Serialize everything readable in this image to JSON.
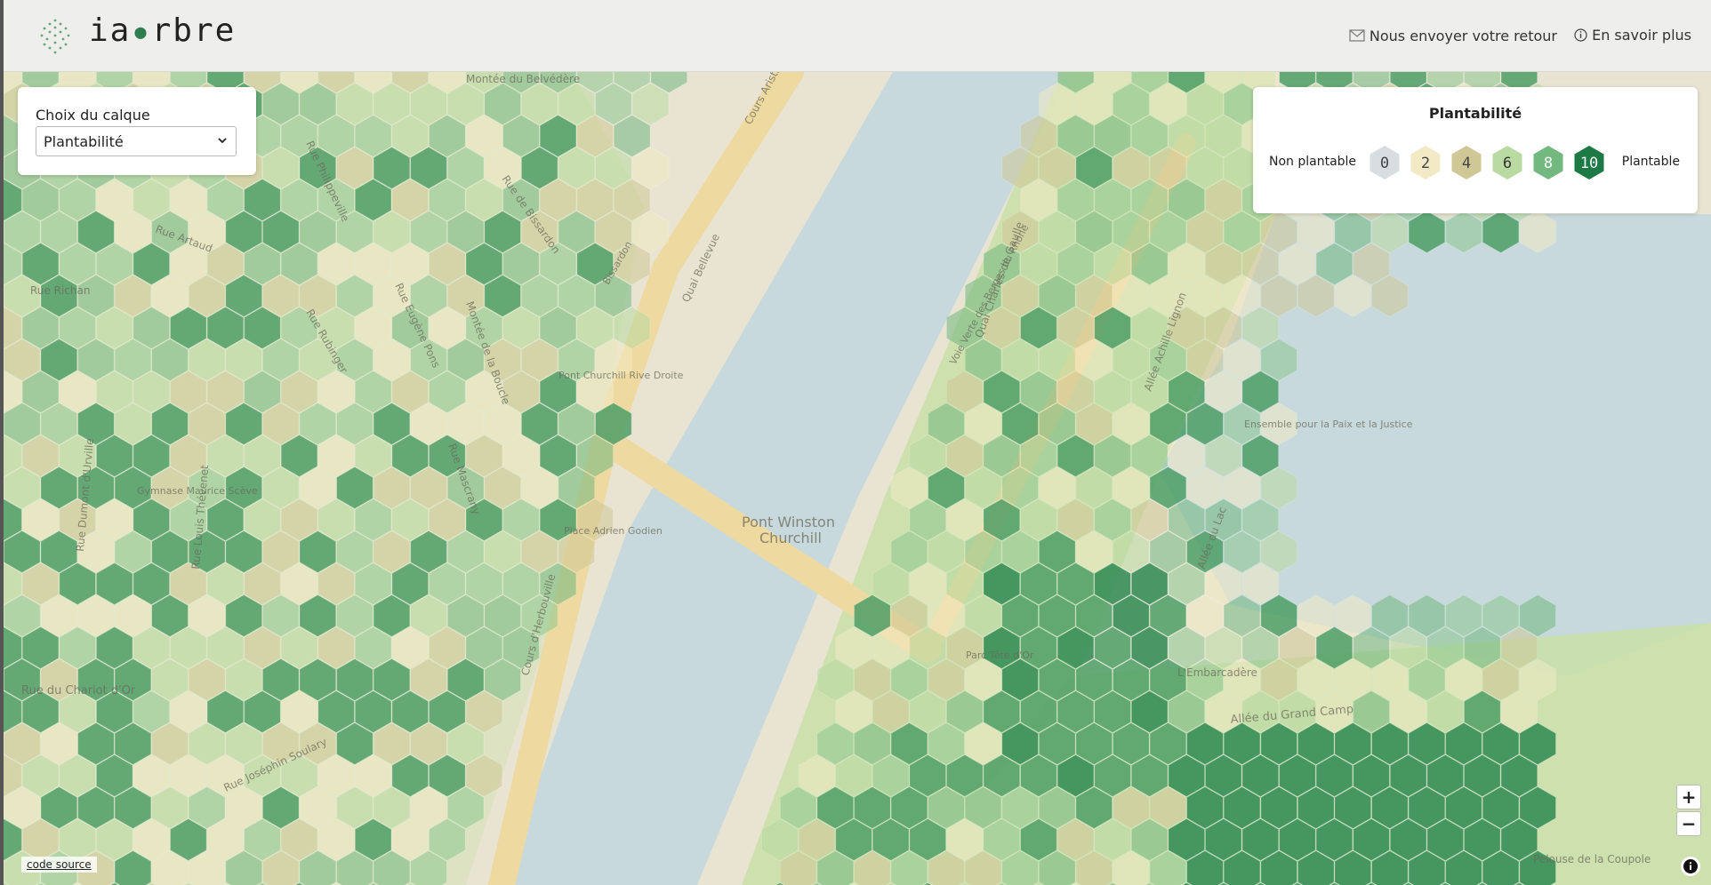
{
  "app": {
    "logo_name": "ia",
    "logo_name_end": "rbre"
  },
  "header": {
    "feedback": "Nous envoyer votre retour",
    "about": "En savoir plus"
  },
  "layer_panel": {
    "label": "Choix du calque",
    "selected": "Plantabilité"
  },
  "legend": {
    "title": "Plantabilité",
    "left_label": "Non plantable",
    "right_label": "Plantable",
    "steps": [
      {
        "value": "0",
        "color": "#d8dee0",
        "text_color": "#444444"
      },
      {
        "value": "2",
        "color": "#f2eac4",
        "text_color": "#444444"
      },
      {
        "value": "4",
        "color": "#cfc896",
        "text_color": "#444444"
      },
      {
        "value": "6",
        "color": "#b9daa0",
        "text_color": "#333333"
      },
      {
        "value": "8",
        "color": "#72b87f",
        "text_color": "#ffffff"
      },
      {
        "value": "10",
        "color": "#1d7a45",
        "text_color": "#ffffff"
      }
    ]
  },
  "controls": {
    "zoom_in": "+",
    "zoom_out": "−"
  },
  "footer": {
    "source": "code source"
  },
  "map": {
    "colors": {
      "land": "#e9e4d2",
      "water": "#c7d9dc",
      "road": "#eed9a0",
      "park": "#c8dfa8"
    },
    "labels": [
      "Montée du Belvédère",
      "Rue de Bissardon",
      "Cours Aristide Briand",
      "Quai Bellevue",
      "Rue Artaud",
      "Rue Eugène Pons",
      "Montée de la Boucle",
      "Rue Philippeville",
      "Rue Richan",
      "Rue Dumont d'Urville",
      "Rue Louis Thévenet",
      "Rue du Chariot d'Or",
      "Rue Joséphin Soulary",
      "Cours d'Herbouville",
      "Pont Winston",
      "Churchill",
      "Quai Charles de Gaulle",
      "Allée Achille Lignon",
      "Allée du Lac",
      "Allée du Grand Camp",
      "L'Embarcadère",
      "Parc Tête d'Or",
      "Place Adrien Godien",
      "Pont Churchill Rive Droite",
      "Gymnase Maurice Scève",
      "Ensemble pour la Paix et la Justice",
      "Pelouse de la Coupole",
      "Rue Mascrany",
      "Rue Rubinger",
      "Bissardon",
      "Voie Verte des Berges du Rhône"
    ]
  }
}
